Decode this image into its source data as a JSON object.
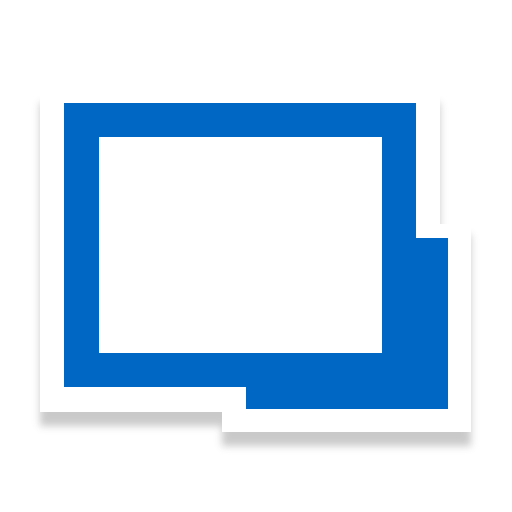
{
  "icon": {
    "name": "remote-desktop-app-icon",
    "glyph": "monitor-window-icon"
  },
  "colors": {
    "accent": "#0067C5",
    "panel": "#FFFFFF",
    "inner": "#FFFFFF",
    "shadow": "#8A8A8A",
    "background": "#FFFFFF"
  }
}
